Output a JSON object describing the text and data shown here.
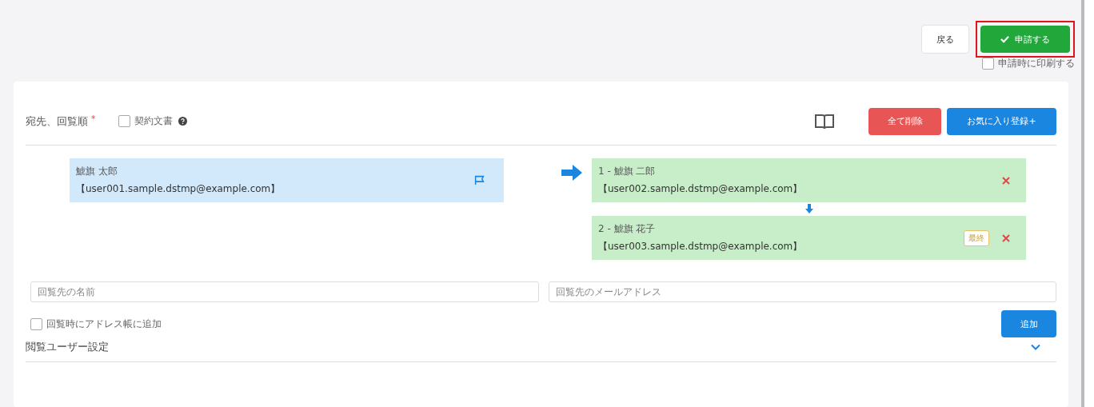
{
  "top_actions": {
    "back_button": "戻る",
    "submit_button": {
      "label": "申請する",
      "highlighted": true
    },
    "print_option": {
      "label": "申請時に印刷する",
      "checked": false
    }
  },
  "recipients_section": {
    "title": "宛先、回覧順",
    "required_mark": "*",
    "contract_option": {
      "label": "契約文書",
      "checked": false
    },
    "delete_all_button": "全て削除",
    "favorite_button": "お気に入り登録+"
  },
  "sender": {
    "name": "鯱旗 太郎",
    "email": "【user001.sample.dstmp@example.com】"
  },
  "recipients": [
    {
      "label": "1 - 鯱旗 二郎",
      "email": "【user002.sample.dstmp@example.com】"
    },
    {
      "label": "2 - 鯱旗 花子",
      "email": "【user003.sample.dstmp@example.com】",
      "badge": "最終"
    }
  ],
  "name_field": {
    "placeholder": "回覧先の名前"
  },
  "email_field": {
    "placeholder": "回覧先のメールアドレス"
  },
  "address_book_option": {
    "label": "回覧時にアドレス帳に追加",
    "checked": false
  },
  "add_button": "追加",
  "viewer_settings": {
    "title": "閲覧ユーザー設定",
    "expanded": false
  }
}
